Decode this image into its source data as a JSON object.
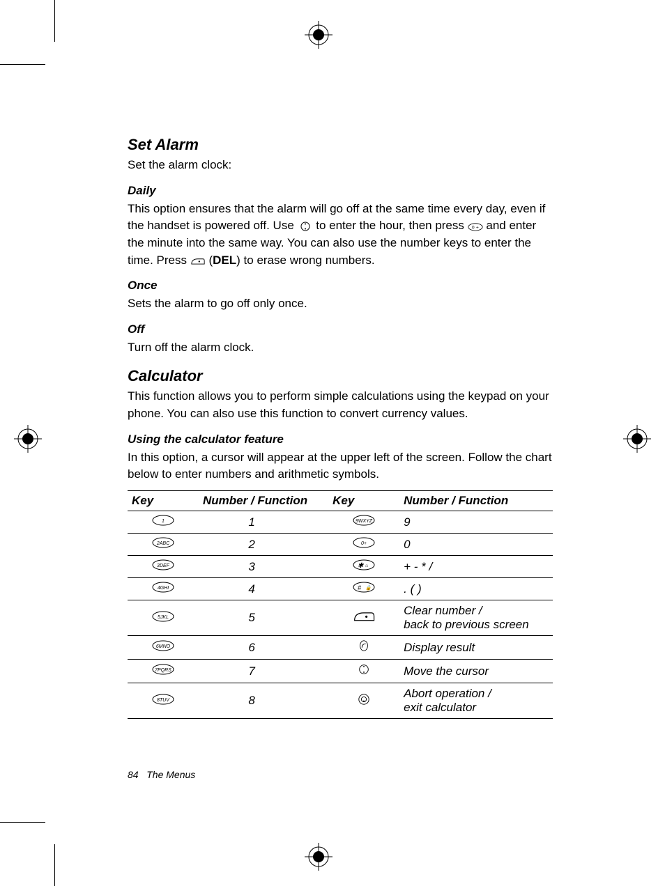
{
  "footer": {
    "page_num": "84",
    "section": "The Menus"
  },
  "set_alarm": {
    "heading": "Set Alarm",
    "intro": "Set the alarm clock:",
    "daily": {
      "heading": "Daily",
      "p1a": "This option ensures that the alarm will go off at the same time every day, even if the handset is powered off. Use ",
      "p1b": " to enter the hour, then press ",
      "p1c": " and enter the minute into the same way. You can also use the number keys to enter the time. Press ",
      "p1d": " (",
      "del": "DEL",
      "p1e": ") to erase wrong numbers."
    },
    "once": {
      "heading": "Once",
      "body": "Sets the alarm to go off only once."
    },
    "off": {
      "heading": "Off",
      "body": "Turn off the alarm clock."
    }
  },
  "calculator": {
    "heading": "Calculator",
    "intro": "This function allows you to perform simple calculations using the keypad on your phone. You can also use this function to convert currency values.",
    "using": {
      "heading": "Using the calculator feature",
      "body": "In this option, a cursor will appear at the upper left of the screen. Follow the chart below to enter numbers and arithmetic symbols."
    },
    "table": {
      "headers": [
        "Key",
        "Number / Function",
        "Key",
        "Number / Function"
      ],
      "rows": [
        {
          "leftKey": "1",
          "leftFn": "1",
          "rightKey": "9wxyz",
          "rightFn": "9"
        },
        {
          "leftKey": "2abc",
          "leftFn": "2",
          "rightKey": "0+",
          "rightFn": "0"
        },
        {
          "leftKey": "3def",
          "leftFn": "3",
          "rightKey": "*",
          "rightFn": "+ - * /"
        },
        {
          "leftKey": "4ghi",
          "leftFn": "4",
          "rightKey": "#",
          "rightFn": ". ( )"
        },
        {
          "leftKey": "5jkl",
          "leftFn": "5",
          "rightKey": "soft-r",
          "rightFn": "Clear number / back to previous screen"
        },
        {
          "leftKey": "6mno",
          "leftFn": "6",
          "rightKey": "send",
          "rightFn": "Display result"
        },
        {
          "leftKey": "7pqrs",
          "leftFn": "7",
          "rightKey": "nav",
          "rightFn": "Move the cursor"
        },
        {
          "leftKey": "8tuv",
          "leftFn": "8",
          "rightKey": "end",
          "rightFn": "Abort operation / exit calculator"
        }
      ]
    }
  },
  "icons": {
    "nav_key": "navigation-key-icon",
    "zero_key": "zero-plus-key-icon",
    "softkey": "right-softkey-icon"
  }
}
